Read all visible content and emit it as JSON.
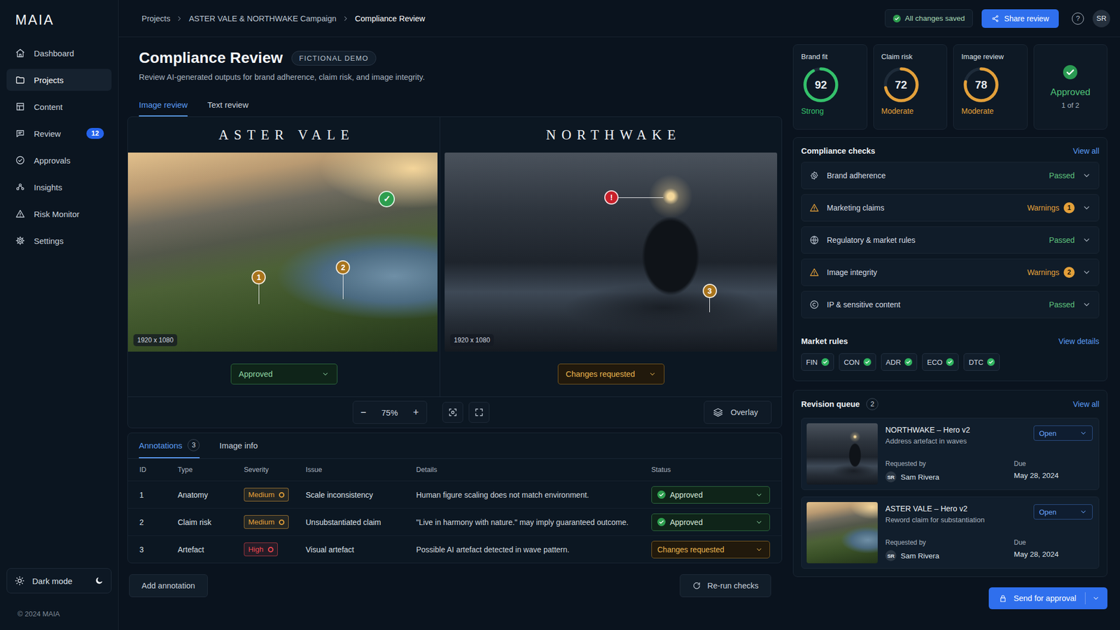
{
  "app": {
    "logo": "MAIA",
    "copyright": "© 2024 MAIA"
  },
  "sidebar": {
    "items": [
      {
        "label": "Dashboard",
        "selected": false
      },
      {
        "label": "Projects",
        "selected": true
      },
      {
        "label": "Content",
        "selected": false
      },
      {
        "label": "Review",
        "selected": false,
        "badge": "12"
      },
      {
        "label": "Approvals",
        "selected": false
      },
      {
        "label": "Insights",
        "selected": false
      },
      {
        "label": "Risk Monitor",
        "selected": false
      },
      {
        "label": "Settings",
        "selected": false
      }
    ],
    "dark_mode": {
      "label": "Dark mode",
      "on": true
    }
  },
  "breadcrumb": [
    {
      "label": "Projects",
      "current": false
    },
    {
      "label": "ASTER VALE & NORTHWAKE Campaign",
      "current": false
    },
    {
      "label": "Compliance Review",
      "current": true
    }
  ],
  "topbar": {
    "save_status": "All changes saved",
    "share": "Share review",
    "help": "?",
    "avatar": "SR"
  },
  "page": {
    "title": "Compliance Review",
    "tag": "FICTIONAL DEMO",
    "subtitle": "Review AI-generated outputs for brand adherence, claim risk, and image integrity."
  },
  "tabs": [
    {
      "label": "Image review",
      "selected": true
    },
    {
      "label": "Text review",
      "selected": false
    }
  ],
  "images": [
    {
      "brand": "ASTER VALE",
      "size": "1920 x 1080",
      "kind": "lake",
      "status": {
        "label": "Approved",
        "kind": "approved"
      },
      "markers": [
        {
          "label": "✓",
          "kind": "badge",
          "color": "#2e9e4f"
        },
        {
          "label": "1",
          "kind": "pin",
          "color": "#a8741c"
        },
        {
          "label": "2",
          "kind": "pin",
          "color": "#a8741c"
        }
      ]
    },
    {
      "brand": "NORTHWAKE",
      "size": "1920 x 1080",
      "kind": "storm",
      "status": {
        "label": "Changes requested",
        "kind": "changes"
      },
      "markers": [
        {
          "label": "!",
          "kind": "pin-side",
          "color": "#c8202a"
        },
        {
          "label": "3",
          "kind": "pin",
          "color": "#a8741c"
        }
      ]
    }
  ],
  "viewer": {
    "zoom_out": "−",
    "zoom": "75%",
    "zoom_in": "+",
    "overlay": "Overlay"
  },
  "annotation_tabs": [
    {
      "label": "Annotations",
      "count": "3",
      "selected": true
    },
    {
      "label": "Image info",
      "selected": false
    }
  ],
  "table": {
    "columns": [
      "ID",
      "Type",
      "Severity",
      "Issue",
      "Details",
      "Status"
    ],
    "rows": [
      {
        "id": "1",
        "type": "Anatomy",
        "severity": "Medium",
        "color": "#e3a03a",
        "issue": "Scale inconsistency",
        "details": "Human figure scaling does not match environment.",
        "status": {
          "label": "Approved",
          "kind": "approved"
        }
      },
      {
        "id": "2",
        "type": "Claim risk",
        "severity": "Medium",
        "color": "#e3a03a",
        "issue": "Unsubstantiated claim",
        "details": "\"Live in harmony with nature.\" may imply guaranteed outcome.",
        "status": {
          "label": "Approved",
          "kind": "approved"
        }
      },
      {
        "id": "3",
        "type": "Artefact",
        "severity": "High",
        "color": "#f0474f",
        "issue": "Visual artefact",
        "details": "Possible AI artefact detected in wave pattern.",
        "status": {
          "label": "Changes requested",
          "kind": "changes"
        }
      }
    ]
  },
  "actions": {
    "add_annotation": "Add annotation",
    "rerun": "Re-run checks",
    "send": "Send for approval"
  },
  "scores": [
    {
      "title": "Brand fit",
      "value": "92",
      "level": 0.92,
      "rating": "Strong",
      "color": "#34c16b"
    },
    {
      "title": "Claim risk",
      "value": "72",
      "level": 0.72,
      "rating": "Moderate",
      "color": "#e3a03a"
    },
    {
      "title": "Image review",
      "value": "78",
      "level": 0.78,
      "rating": "Moderate",
      "color": "#e3a03a"
    }
  ],
  "approval": {
    "label": "Approved",
    "progress": "1 of 2"
  },
  "compliance": {
    "title": "Compliance checks",
    "link": "View all",
    "items": [
      {
        "label": "Brand adherence",
        "status": "Passed",
        "kind": "passed",
        "expanded": false
      },
      {
        "label": "Marketing claims",
        "status": "Warnings",
        "kind": "warning",
        "count": "1",
        "expanded": false
      },
      {
        "label": "Regulatory & market rules",
        "status": "Passed",
        "kind": "passed",
        "expanded": false
      },
      {
        "label": "Image integrity",
        "status": "Warnings",
        "kind": "warning",
        "count": "2",
        "expanded": false
      },
      {
        "label": "IP & sensitive content",
        "status": "Passed",
        "kind": "passed",
        "expanded": false
      }
    ]
  },
  "market_rules": {
    "title": "Market rules",
    "link": "View details",
    "tags": [
      {
        "label": "FIN",
        "passed": true
      },
      {
        "label": "CON",
        "passed": true
      },
      {
        "label": "ADR",
        "passed": true
      },
      {
        "label": "ECO",
        "passed": true
      },
      {
        "label": "DTC",
        "passed": true
      }
    ]
  },
  "revision_queue": {
    "title": "Revision queue",
    "count": "2",
    "link": "View all",
    "items": [
      {
        "title": "NORTHWAKE – Hero v2",
        "note": "Address artefact in waves",
        "status": "Open",
        "requested_label": "Requested by",
        "initials": "SR",
        "requester": "Sam Rivera",
        "due_label": "Due",
        "due": "May 28, 2024",
        "kind": "storm"
      },
      {
        "title": "ASTER VALE – Hero v2",
        "note": "Reword claim for substantiation",
        "status": "Open",
        "requested_label": "Requested by",
        "initials": "SR",
        "requester": "Sam Rivera",
        "due_label": "Due",
        "due": "May 28, 2024",
        "kind": "lake"
      }
    ]
  }
}
